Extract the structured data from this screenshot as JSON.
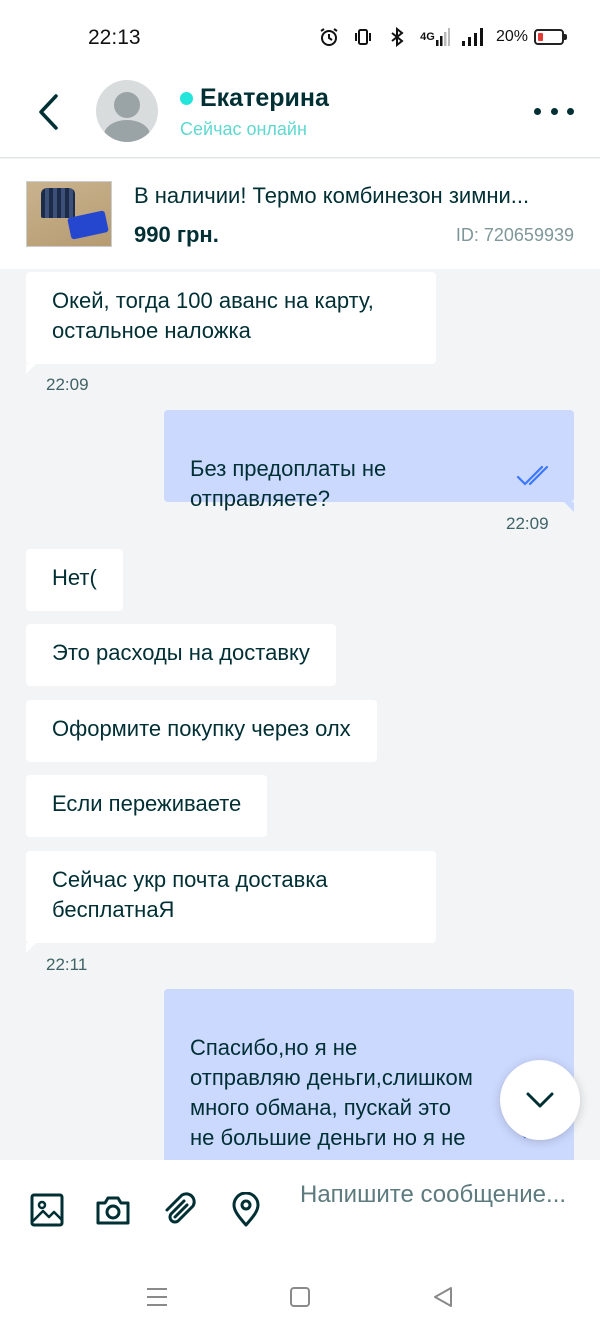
{
  "status_bar": {
    "time": "22:13",
    "network": "4G",
    "battery": "20%",
    "battery_level": 0.2,
    "icons": [
      "alarm-icon",
      "vibrate-icon",
      "bluetooth-icon",
      "mobile-data-icon",
      "signal-icon",
      "battery-icon"
    ]
  },
  "header": {
    "contact_name": "Екатерина",
    "status": "Сейчас онлайн",
    "status_color": "#23e5db"
  },
  "ad": {
    "title": "В наличии! Термо комбинезон зимни...",
    "price": "990 грн.",
    "id": "ID: 720659939"
  },
  "messages": [
    {
      "direction": "in",
      "text": "Окей, тогда 100 аванс на карту,\nостальное наложка"
    },
    {
      "time": "22:09"
    },
    {
      "direction": "out",
      "text": "Без предоплаты не\nотправляете?",
      "read": true
    },
    {
      "time": "22:09"
    },
    {
      "direction": "in",
      "text": "Нет("
    },
    {
      "direction": "in",
      "text": "Это расходы на доставку"
    },
    {
      "direction": "in",
      "text": "Оформите покупку через олх"
    },
    {
      "direction": "in",
      "text": "Если переживаете"
    },
    {
      "direction": "in",
      "text": "Сейчас укр почта доставка\nбесплатнаЯ"
    },
    {
      "time": "22:11"
    },
    {
      "direction": "out",
      "text": "Спасибо,но я не\nотправляю деньги,слишком\nмного обмана, пускай это\nне большие деньги но я не\nхочу рисковать",
      "read": true
    }
  ],
  "input": {
    "placeholder": "Напишите сообщение..."
  },
  "colors": {
    "accent": "#23e5db",
    "outgoing_bubble": "#ccd9ff",
    "incoming_bubble": "#ffffff",
    "text": "#002f34",
    "read_ticks": "#3a77ff"
  }
}
